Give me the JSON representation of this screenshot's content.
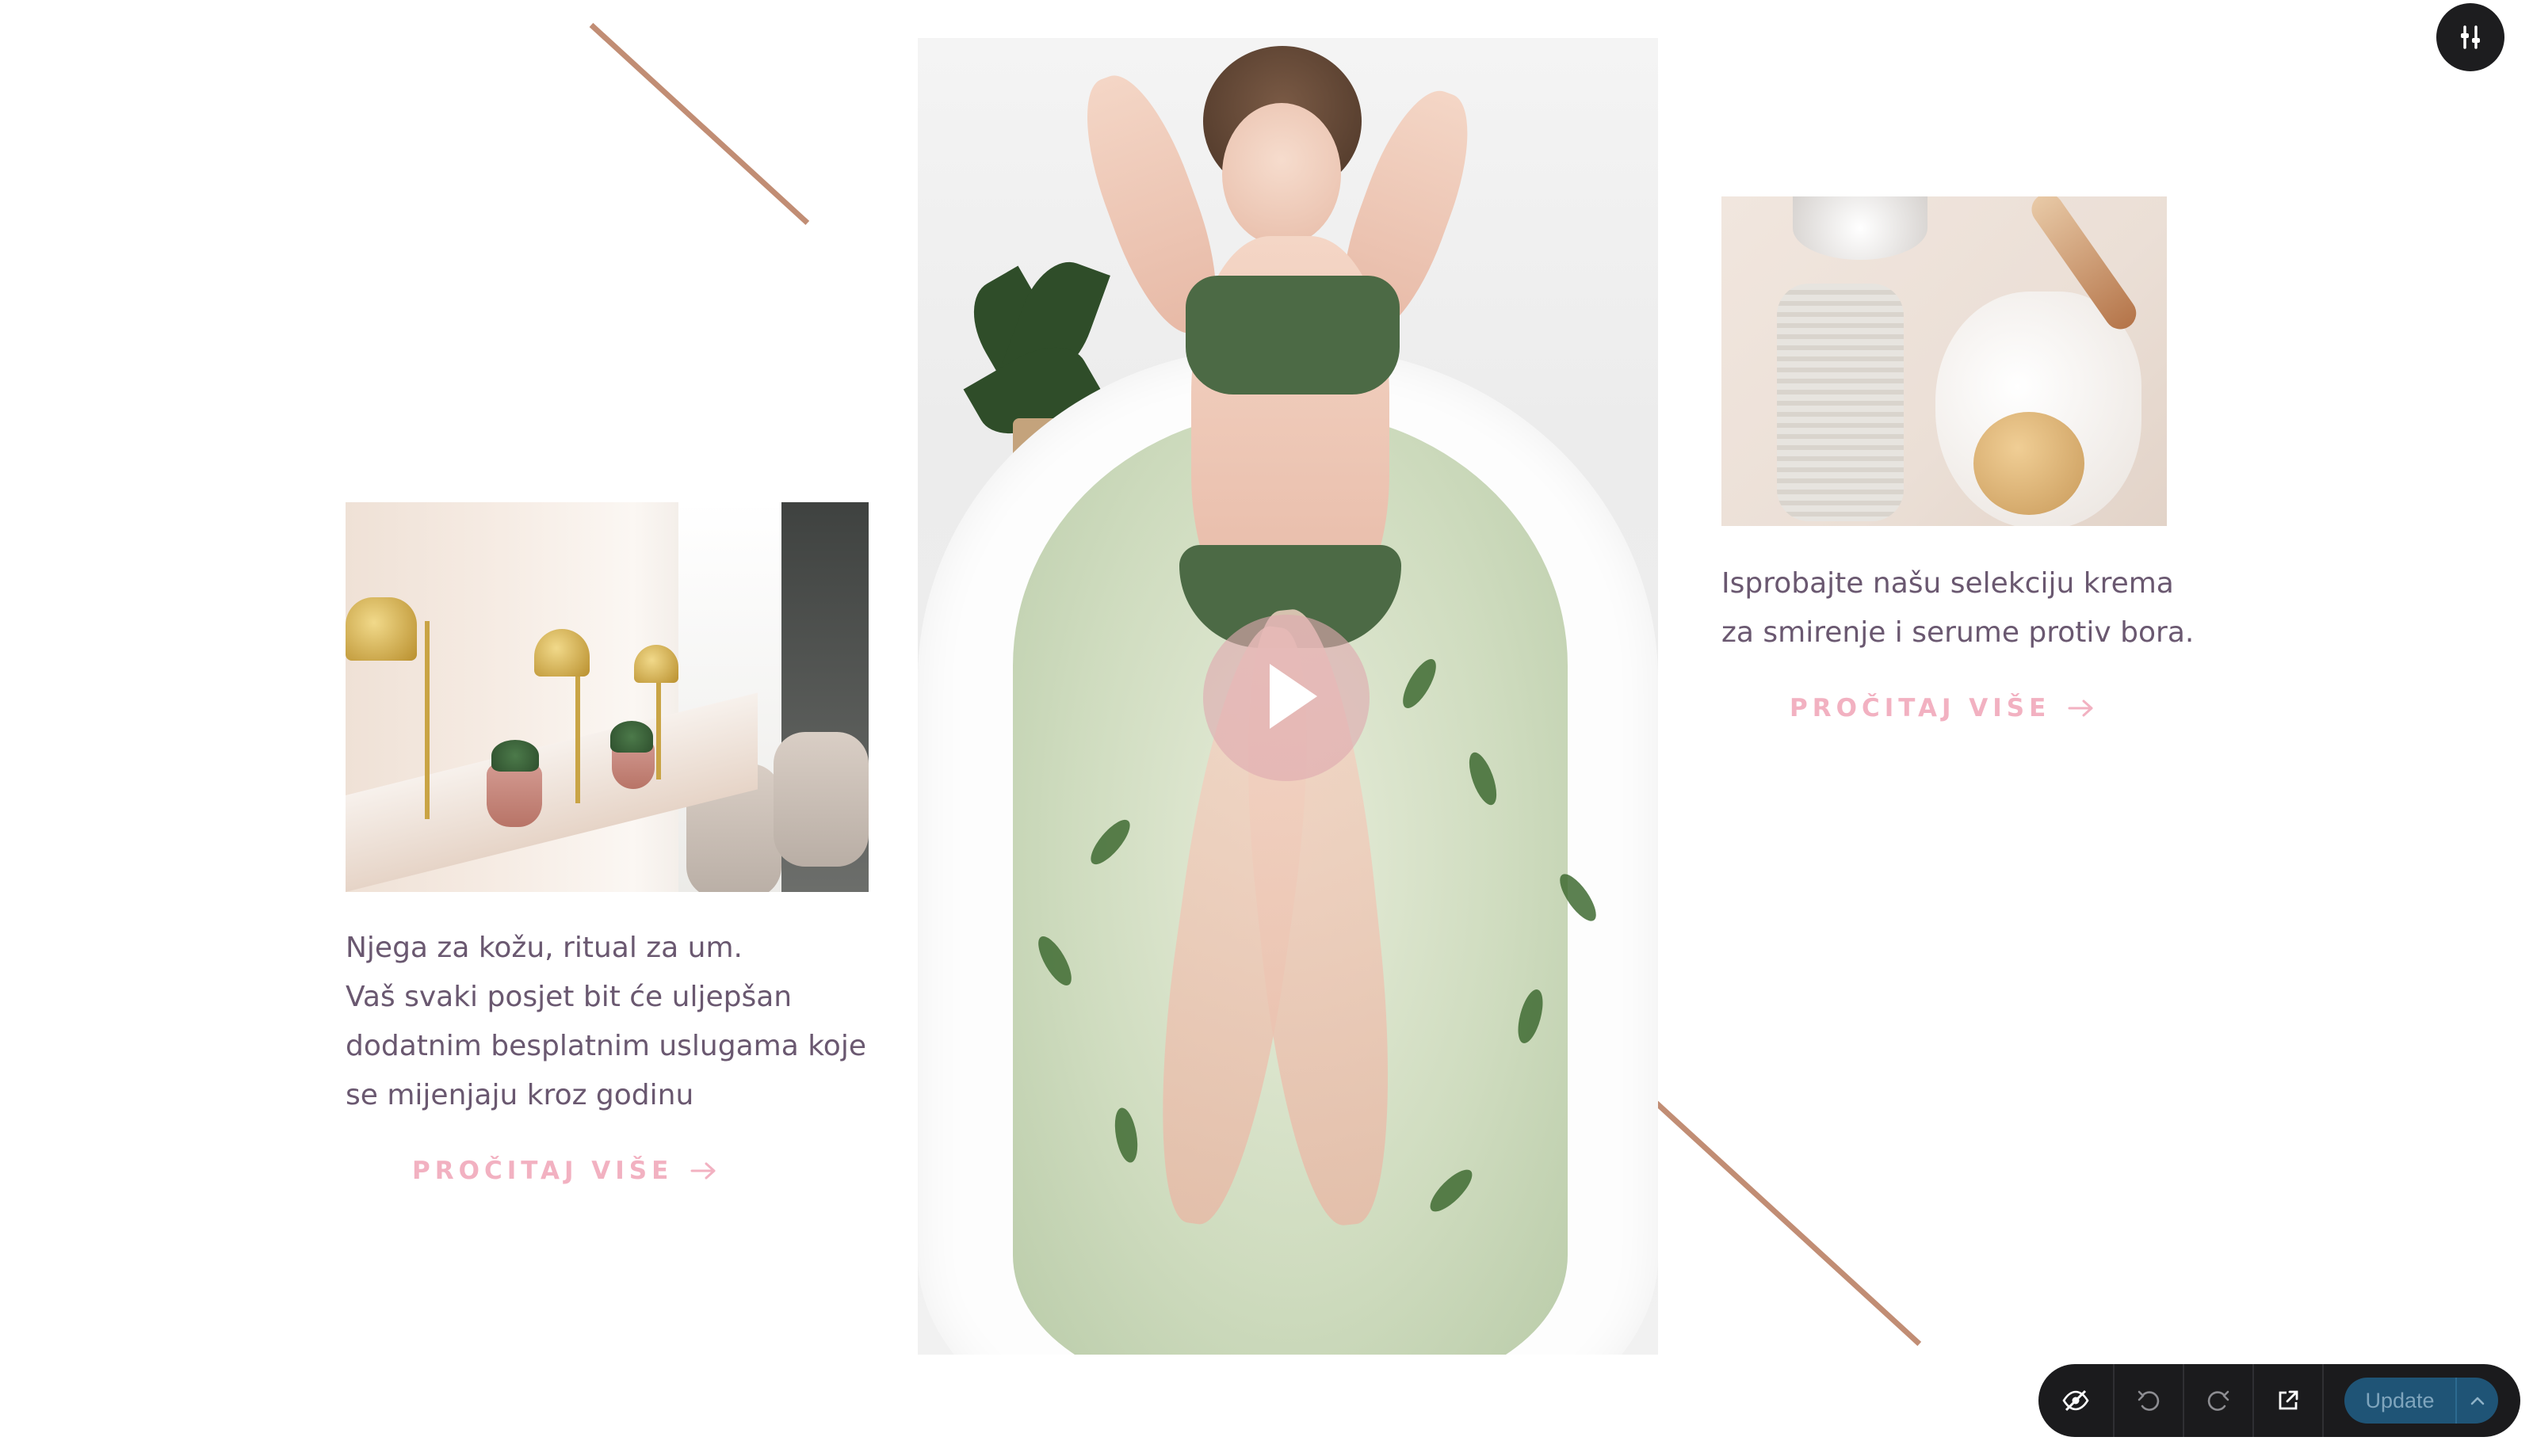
{
  "blocks": {
    "left": {
      "paragraph": "Njega za kožu, ritual za um.\nVaš svaki posjet bit će uljepšan\ndodatnim besplatnim uslugama koje\nse mijenjaju kroz godinu",
      "read_more": "PROČITAJ VIŠE"
    },
    "right": {
      "paragraph": "Isprobajte našu selekciju krema\nza smirenje i serume protiv bora.",
      "read_more": "PROČITAJ VIŠE"
    }
  },
  "toolbar": {
    "update_label": "Update"
  },
  "icons": {
    "settings": "sliders-icon",
    "hide": "eye-off-icon",
    "undo": "undo-icon",
    "redo": "redo-icon",
    "open": "external-link-icon",
    "play": "play-icon",
    "arrow": "arrow-right-icon",
    "caret": "chevron-up-icon"
  },
  "colors": {
    "accent_pink": "#f2b1c1",
    "text_purple": "#6a5870",
    "diagonal_line": "#c18d74",
    "toolbar_bg": "#1b1b1d",
    "update_button": "#1f5476"
  }
}
